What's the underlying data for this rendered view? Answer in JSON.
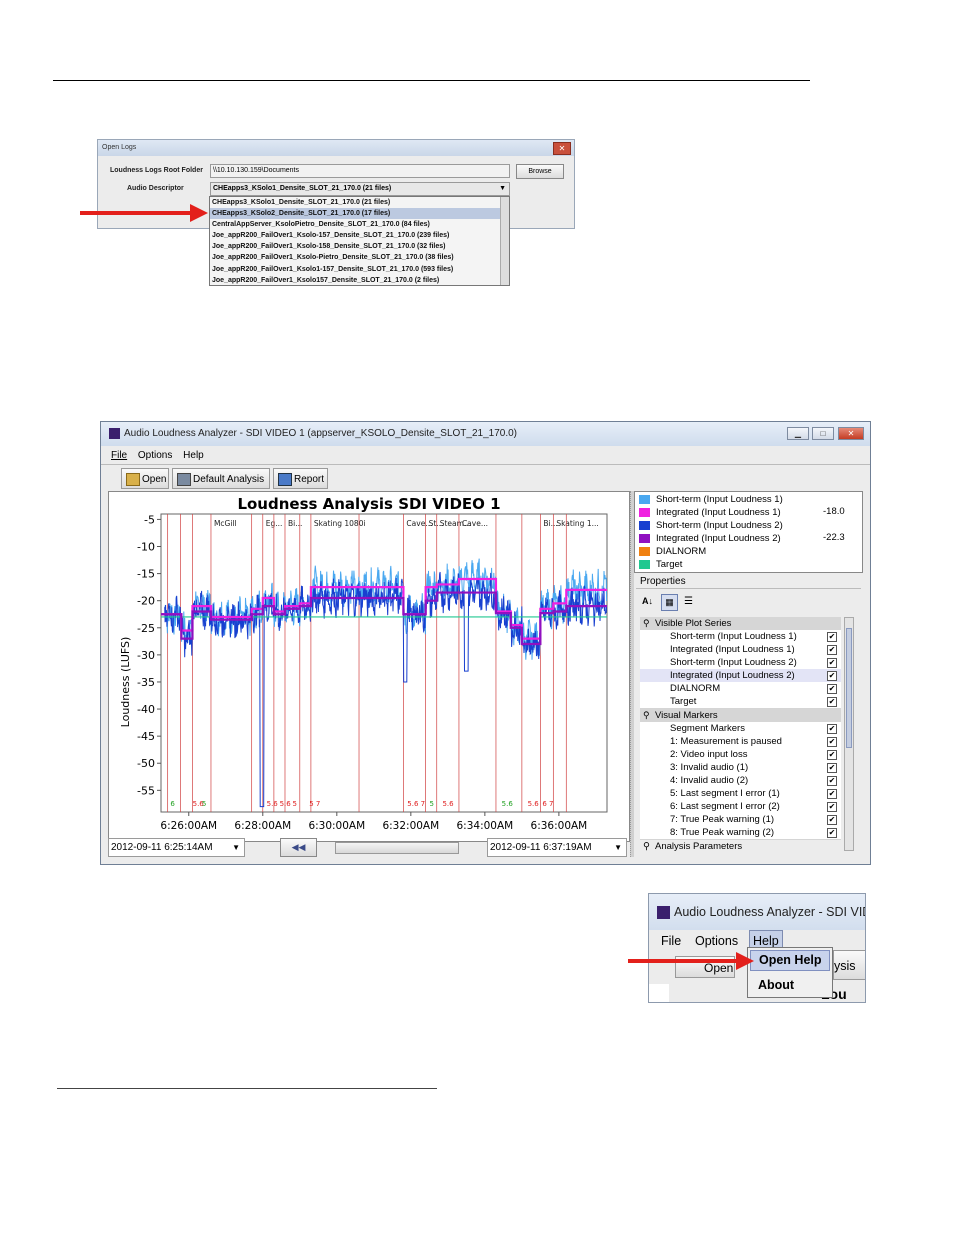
{
  "open_logs": {
    "title": "Open Logs",
    "root_folder_label": "Loudness Logs Root Folder",
    "root_folder_value": "\\\\10.10.130.159\\Documents",
    "browse_label": "Browse",
    "audio_descriptor_label": "Audio Descriptor",
    "audio_descriptor_value": "CHEapps3_KSolo1_Densite_SLOT_21_170.0 (21 files)",
    "options": [
      "CHEapps3_KSolo1_Densite_SLOT_21_170.0 (21 files)",
      "CHEapps3_KSolo2_Densite_SLOT_21_170.0 (17 files)",
      "CentralAppServer_KsoloPietro_Densite_SLOT_21_170.0 (84 files)",
      "Joe_appR200_FailOver1_Ksolo-157_Densite_SLOT_21_170.0 (239 files)",
      "Joe_appR200_FailOver1_Ksolo-158_Densite_SLOT_21_170.0 (32 files)",
      "Joe_appR200_FailOver1_Ksolo-Pietro_Densite_SLOT_21_170.0 (38 files)",
      "Joe_appR200_FailOver1_Ksolo1-157_Densite_SLOT_21_170.0 (593 files)",
      "Joe_appR200_FailOver1_Ksolo157_Densite_SLOT_21_170.0 (2 files)"
    ],
    "selected_index": 1
  },
  "main_window": {
    "title": "Audio Loudness Analyzer - SDI VIDEO 1 (appserver_KSOLO_Densite_SLOT_21_170.0)",
    "menu": [
      "File",
      "Options",
      "Help"
    ],
    "toolbar": {
      "open": "Open",
      "default_analysis": "Default Analysis",
      "report": "Report"
    },
    "start_time": "2012-09-11 6:25:14AM",
    "end_time": "2012-09-11 6:37:19AM",
    "rewind_label": "◀◀"
  },
  "legend": [
    {
      "name": "Short-term (Input Loudness 1)",
      "color": "#4aa8f0",
      "value": ""
    },
    {
      "name": "Integrated (Input Loudness 1)",
      "color": "#f020e0",
      "value": "-18.0"
    },
    {
      "name": "Short-term (Input Loudness 2)",
      "color": "#1840d0",
      "value": ""
    },
    {
      "name": "Integrated (Input Loudness 2)",
      "color": "#9010c0",
      "value": "-22.3"
    },
    {
      "name": "DIALNORM",
      "color": "#f08010",
      "value": ""
    },
    {
      "name": "Target",
      "color": "#20c890",
      "value": ""
    }
  ],
  "properties": {
    "header": "Properties",
    "sections": [
      {
        "title": "Visible Plot Series",
        "items": [
          "Short-term (Input Loudness 1)",
          "Integrated (Input Loudness 1)",
          "Short-term (Input Loudness 2)",
          "Integrated (Input Loudness 2)",
          "DIALNORM",
          "Target"
        ]
      },
      {
        "title": "Visual Markers",
        "items": [
          "Segment Markers",
          "1: Measurement is paused",
          "2: Video input loss",
          "3: Invalid audio (1)",
          "4: Invalid audio (2)",
          "5: Last segment I error (1)",
          "6: Last segment I error (2)",
          "7: True Peak warning (1)",
          "8: True Peak warning (2)"
        ]
      }
    ],
    "footer": "Analysis Parameters"
  },
  "chart_data": {
    "type": "line",
    "title": "Loudness Analysis SDI VIDEO 1",
    "xlabel": "",
    "ylabel": "Loudness (LUFS)",
    "x_ticks": [
      "6:26:00AM",
      "6:28:00AM",
      "6:30:00AM",
      "6:32:00AM",
      "6:34:00AM",
      "6:36:00AM"
    ],
    "y_ticks": [
      -5,
      -10,
      -15,
      -20,
      -25,
      -30,
      -35,
      -40,
      -45,
      -50,
      -55
    ],
    "ylim": [
      -59,
      -4
    ],
    "x_range_minutes": [
      25.25,
      37.3
    ],
    "segments": [
      {
        "x": 25.43,
        "label": ""
      },
      {
        "x": 25.78,
        "label": ""
      },
      {
        "x": 26.1,
        "label": ""
      },
      {
        "x": 26.6,
        "label": "McGill"
      },
      {
        "x": 27.7,
        "label": ""
      },
      {
        "x": 28.0,
        "label": "Eg..."
      },
      {
        "x": 28.3,
        "label": ""
      },
      {
        "x": 28.6,
        "label": "Bi..."
      },
      {
        "x": 29.0,
        "label": ""
      },
      {
        "x": 29.3,
        "label": "Skating 1080i"
      },
      {
        "x": 30.6,
        "label": ""
      },
      {
        "x": 31.8,
        "label": "Cave..."
      },
      {
        "x": 32.4,
        "label": "St..."
      },
      {
        "x": 32.7,
        "label": "Steam..."
      },
      {
        "x": 33.3,
        "label": "Cave..."
      },
      {
        "x": 34.3,
        "label": ""
      },
      {
        "x": 35.0,
        "label": ""
      },
      {
        "x": 35.5,
        "label": "Bi..."
      },
      {
        "x": 35.85,
        "label": "Skating 1..."
      },
      {
        "x": 36.2,
        "label": ""
      }
    ],
    "marker_codes": [
      {
        "x": 25.45,
        "text": "6",
        "color": "#20a020"
      },
      {
        "x": 26.05,
        "text": "5.6",
        "color": "#e02020"
      },
      {
        "x": 26.3,
        "text": "5",
        "color": "#20a020"
      },
      {
        "x": 28.05,
        "text": "5.6",
        "color": "#e02020"
      },
      {
        "x": 28.4,
        "text": "5.6",
        "color": "#e02020"
      },
      {
        "x": 28.75,
        "text": "5",
        "color": "#e02020"
      },
      {
        "x": 29.2,
        "text": "5 7",
        "color": "#e02020"
      },
      {
        "x": 31.85,
        "text": "5.6 7",
        "color": "#e02020"
      },
      {
        "x": 32.45,
        "text": "5",
        "color": "#20a020"
      },
      {
        "x": 32.8,
        "text": "5.6",
        "color": "#e02020"
      },
      {
        "x": 34.4,
        "text": "5.6",
        "color": "#20a020"
      },
      {
        "x": 35.1,
        "text": "5.6",
        "color": "#e02020"
      },
      {
        "x": 35.5,
        "text": "6 7",
        "color": "#e02020"
      }
    ],
    "series": [
      {
        "name": "Integrated (Input Loudness 1)",
        "color": "#f020e0",
        "step": true,
        "x": [
          25.25,
          25.45,
          25.8,
          26.1,
          26.6,
          27.7,
          28.0,
          28.3,
          28.6,
          29.0,
          29.3,
          30.6,
          31.8,
          32.4,
          32.7,
          33.3,
          34.3,
          34.7,
          35.0,
          35.5,
          35.85,
          36.2,
          37.3
        ],
        "y": [
          -22.5,
          -22.5,
          -25.5,
          -21,
          -23,
          -21.5,
          -19.5,
          -22,
          -21,
          -20.5,
          -17.5,
          -17.5,
          -22.5,
          -17.5,
          -17,
          -16,
          -22,
          -24.5,
          -27,
          -21.5,
          -20.5,
          -18,
          -18
        ]
      },
      {
        "name": "Integrated (Input Loudness 2)",
        "color": "#9010c0",
        "step": true,
        "x": [
          25.25,
          25.45,
          25.8,
          26.1,
          26.6,
          27.7,
          28.0,
          28.3,
          28.6,
          29.0,
          29.3,
          30.6,
          31.8,
          32.4,
          32.7,
          33.3,
          34.3,
          34.7,
          35.0,
          35.5,
          35.85,
          36.2,
          37.3
        ],
        "y": [
          -22.5,
          -22.5,
          -27,
          -22,
          -23.5,
          -22.5,
          -21,
          -22.5,
          -21.5,
          -21,
          -19.5,
          -19.5,
          -22.5,
          -20,
          -18.5,
          -18.5,
          -22.3,
          -25,
          -28,
          -22.3,
          -22,
          -21,
          -21
        ]
      },
      {
        "name": "Target",
        "color": "#20c890",
        "y_const": -23
      },
      {
        "name": "Short-term (Input Loudness 1)",
        "color": "#4aa8f0",
        "noisy": true
      },
      {
        "name": "Short-term (Input Loudness 2)",
        "color": "#1840d0",
        "noisy": true
      }
    ]
  },
  "help_crop": {
    "title": "Audio Loudness Analyzer - SDI VID",
    "menu": [
      "File",
      "Options",
      "Help"
    ],
    "items": [
      "Open Help",
      "About"
    ],
    "toolbar_peek": [
      "Open",
      "ysis",
      "Lou"
    ]
  }
}
